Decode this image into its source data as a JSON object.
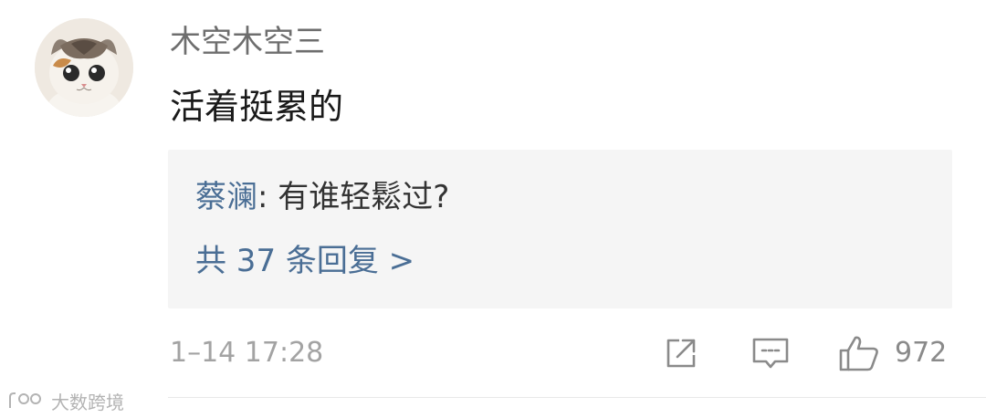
{
  "comment": {
    "username": "木空木空三",
    "text": "活着挺累的",
    "avatar_icon": "cat-avatar"
  },
  "reply": {
    "author": "蔡澜",
    "separator": ": ",
    "text": "有谁轻鬆过?",
    "count_label": "共 37 条回复 >"
  },
  "meta": {
    "time": "1–14 17:28",
    "like_count": "972"
  },
  "icons": {
    "share": "share-icon",
    "comment": "comment-icon",
    "like": "thumbs-up-icon"
  },
  "watermark": {
    "text": "大数跨境"
  },
  "colors": {
    "link_blue": "#4a6e95",
    "reply_background": "#f5f5f5",
    "muted_gray": "#a3a3a3"
  }
}
